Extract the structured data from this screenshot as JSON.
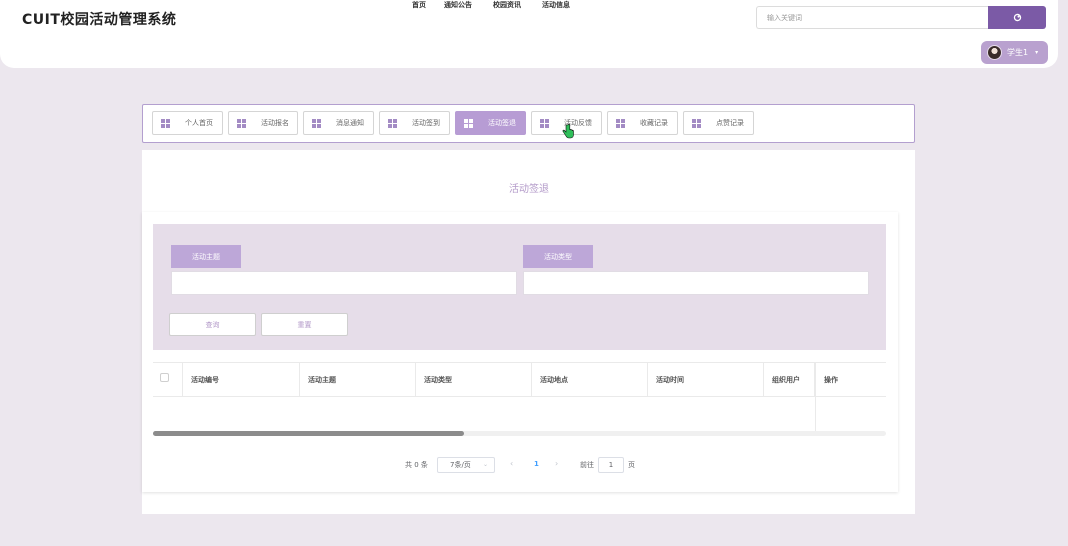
{
  "header": {
    "logo": "CUIT校园活动管理系统",
    "search_placeholder": "输入关键词",
    "nav": [
      "首页",
      "通知公告",
      "校园资讯",
      "活动信息"
    ],
    "user_name": "学生1"
  },
  "tabs": [
    {
      "label": "个人首页",
      "active": false
    },
    {
      "label": "活动报名",
      "active": false
    },
    {
      "label": "消息通知",
      "active": false
    },
    {
      "label": "活动签到",
      "active": false
    },
    {
      "label": "活动签退",
      "active": true
    },
    {
      "label": "活动反馈",
      "active": false
    },
    {
      "label": "收藏记录",
      "active": false
    },
    {
      "label": "点赞记录",
      "active": false
    }
  ],
  "page": {
    "title": "活动签退",
    "filters": {
      "theme_label": "活动主题",
      "type_label": "活动类型",
      "query_button": "查询",
      "reset_button": "重置"
    },
    "table": {
      "columns": [
        "活动编号",
        "活动主题",
        "活动类型",
        "活动地点",
        "活动时间",
        "组织用户",
        "操作"
      ],
      "rows": []
    },
    "pagination": {
      "total": "共 0 条",
      "page_size": "7条/页",
      "current_page": "1",
      "goto_label": "前往",
      "goto_value": "1",
      "page_suffix": "页"
    }
  },
  "colors": {
    "accent": "#7b5aa6",
    "accent_light": "#b79cd4",
    "background": "#ece7ee"
  }
}
